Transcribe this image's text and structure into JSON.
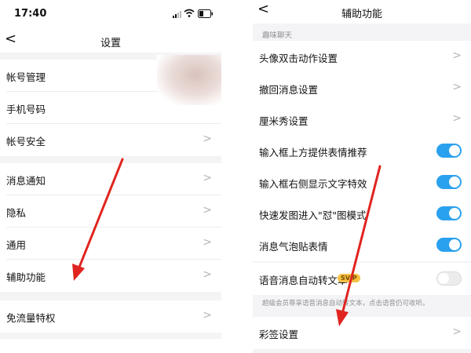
{
  "left": {
    "status": {
      "time": "17:40"
    },
    "nav": {
      "back": "<",
      "title": "设置"
    },
    "rows": [
      {
        "label": "帐号管理",
        "chevron": false
      },
      {
        "label": "手机号码",
        "chevron": false
      },
      {
        "label": "帐号安全",
        "chevron": true
      },
      {
        "label": "消息通知",
        "chevron": true
      },
      {
        "label": "隐私",
        "chevron": true
      },
      {
        "label": "通用",
        "chevron": true
      },
      {
        "label": "辅助功能",
        "chevron": true
      },
      {
        "label": "免流量特权",
        "chevron": true
      }
    ]
  },
  "right": {
    "nav": {
      "back": "<",
      "title": "辅助功能"
    },
    "section_title": "趣味聊天",
    "rows": [
      {
        "label": "头像双击动作设置",
        "control": "chevron"
      },
      {
        "label": "撤回消息设置",
        "control": "chevron"
      },
      {
        "label": "厘米秀设置",
        "control": "chevron"
      },
      {
        "label": "输入框上方提供表情推荐",
        "control": "toggle",
        "on": true
      },
      {
        "label": "输入框右侧显示文字特效",
        "control": "toggle",
        "on": true
      },
      {
        "label": "快速发图进入\"怼\"图模式",
        "control": "toggle",
        "on": true
      },
      {
        "label": "消息气泡贴表情",
        "control": "toggle",
        "on": true
      },
      {
        "label": "语音消息自动转文本",
        "badge": "SVIP",
        "control": "toggle",
        "on": false
      },
      {
        "label": "彩签设置",
        "control": "chevron"
      }
    ],
    "note": "超级会员尊享语音消息自动转文本，点击语音仍可收听。"
  },
  "colors": {
    "toggle_on": "#2aa1ef",
    "arrow": "#e0241f",
    "background": "#f4f4f6"
  }
}
